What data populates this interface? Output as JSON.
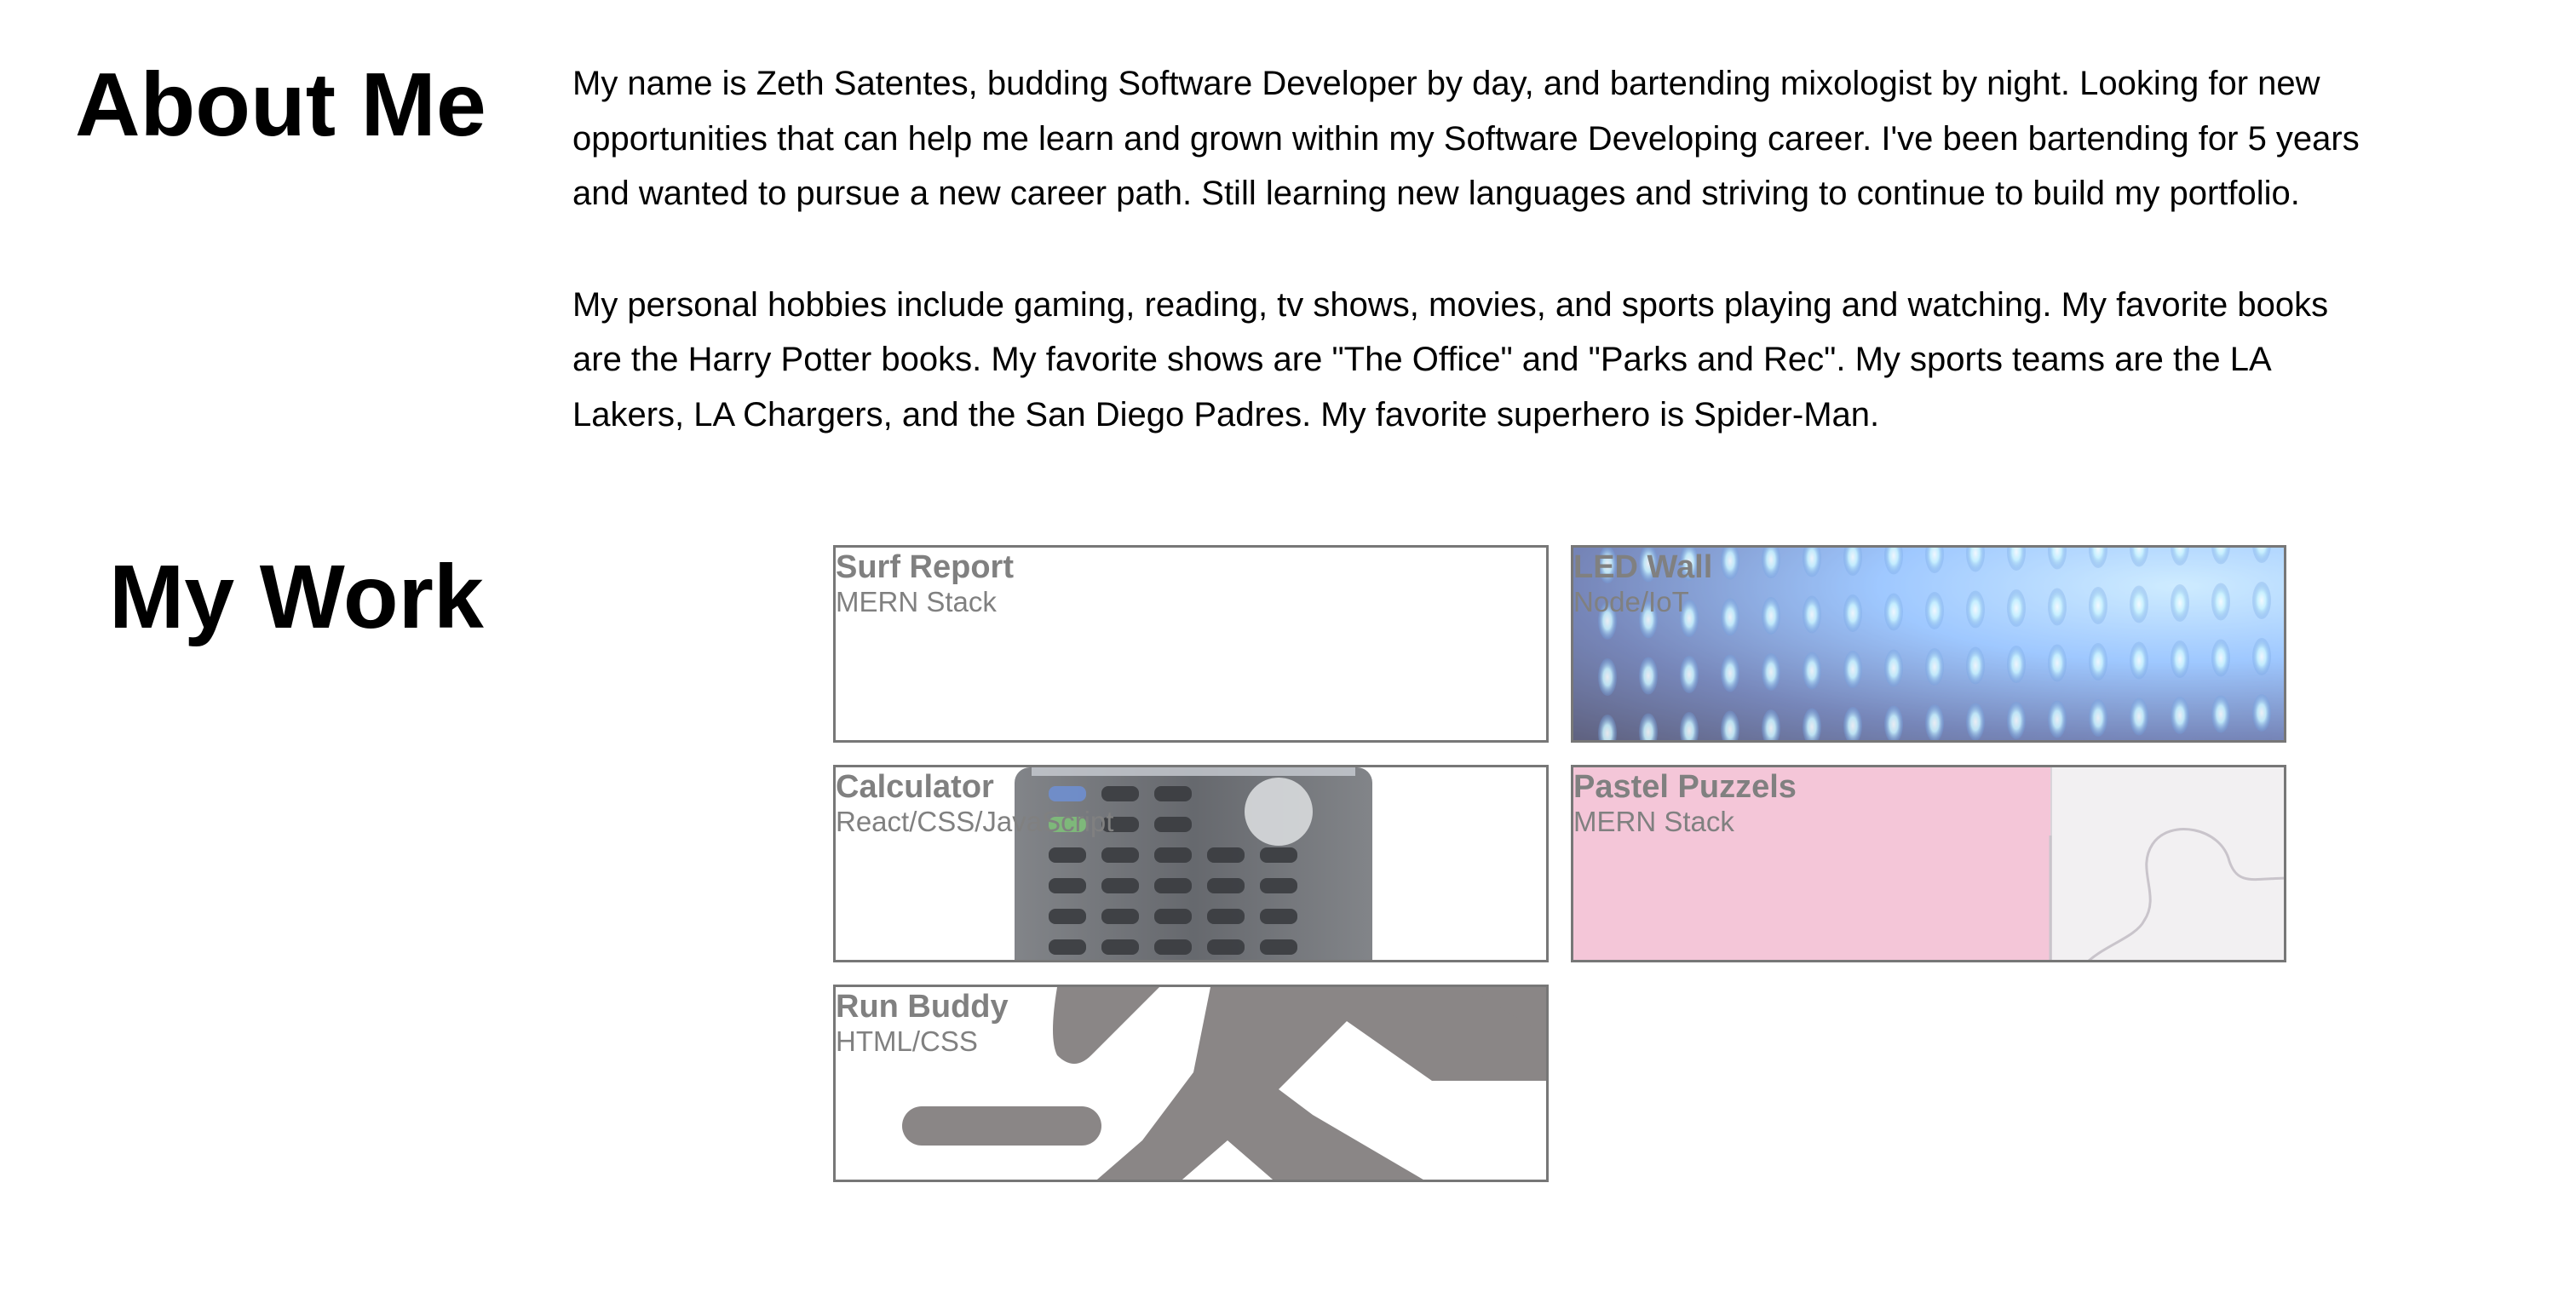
{
  "about": {
    "heading": "About Me",
    "paragraph1": "My name is Zeth Satentes, budding Software Developer by day, and bartending mixologist by night. Looking for new opportunities that can help me learn and grown within my Software Developing career. I've been bartending for 5 years and wanted to pursue a new career path. Still learning new languages and striving to continue to build my portfolio.",
    "paragraph2": "My personal hobbies include gaming, reading, tv shows, movies, and sports playing and watching. My favorite books are the Harry Potter books. My favorite shows are \"The Office\" and \"Parks and Rec\". My sports teams are the LA Lakers, LA Chargers, and the San Diego Padres. My favorite superhero is Spider-Man."
  },
  "work": {
    "heading": "My Work",
    "projects": [
      {
        "title": "Surf Report",
        "stack": "MERN Stack",
        "art": "blank"
      },
      {
        "title": "LED Wall",
        "stack": "Node/IoT",
        "art": "led-wall-image"
      },
      {
        "title": "Calculator",
        "stack": "React/CSS/JavaScript",
        "art": "calculator-image"
      },
      {
        "title": "Pastel Puzzels",
        "stack": "MERN Stack",
        "art": "puzzle-image"
      },
      {
        "title": "Run Buddy",
        "stack": "HTML/CSS",
        "art": "runner-icon-image"
      }
    ]
  },
  "colors": {
    "text": "#000000",
    "card_text": "#808080",
    "card_border": "#777777",
    "pastel_pink": "#f4c6d8",
    "runner_gray": "#8a8686"
  }
}
